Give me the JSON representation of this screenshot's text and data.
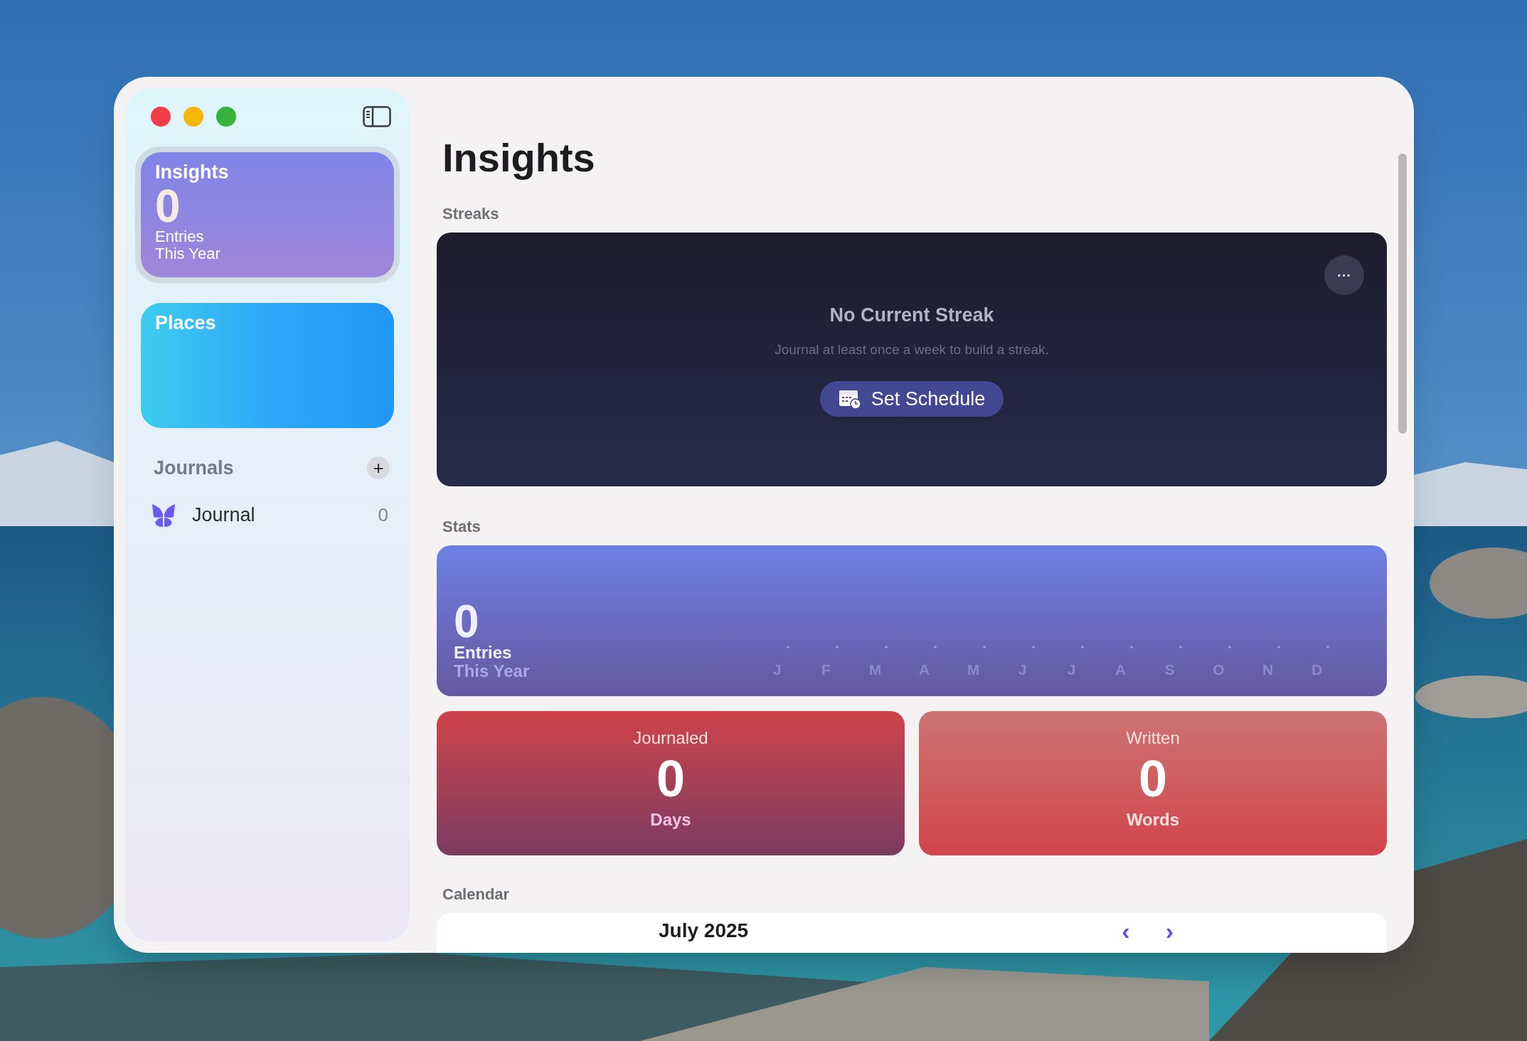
{
  "sidebar": {
    "cards": [
      {
        "kind": "insights",
        "title": "Insights",
        "value": "0",
        "label": "Entries",
        "sublabel": "This Year",
        "selected": true
      },
      {
        "kind": "places",
        "title": "Places",
        "selected": false
      }
    ],
    "journals_header": "Journals",
    "add_button": "+",
    "journals": [
      {
        "name": "Journal",
        "count": "0",
        "color": "#6b5cf0"
      }
    ]
  },
  "main": {
    "title": "Insights",
    "streaks": {
      "section": "Streaks",
      "more_button": "···",
      "heading": "No Current Streak",
      "message": "Journal at least once a week to build a streak.",
      "button": "Set Schedule"
    },
    "stats": {
      "section": "Stats",
      "value": "0",
      "label": "Entries",
      "sublabel": "This Year",
      "months": [
        "J",
        "F",
        "M",
        "A",
        "M",
        "J",
        "J",
        "A",
        "S",
        "O",
        "N",
        "D"
      ]
    },
    "tiles": [
      {
        "kind": "days",
        "title": "Journaled",
        "value": "0",
        "unit": "Days"
      },
      {
        "kind": "words",
        "title": "Written",
        "value": "0",
        "unit": "Words"
      }
    ],
    "calendar": {
      "section": "Calendar",
      "month": "July 2025",
      "prev": "‹",
      "next": "›"
    }
  }
}
